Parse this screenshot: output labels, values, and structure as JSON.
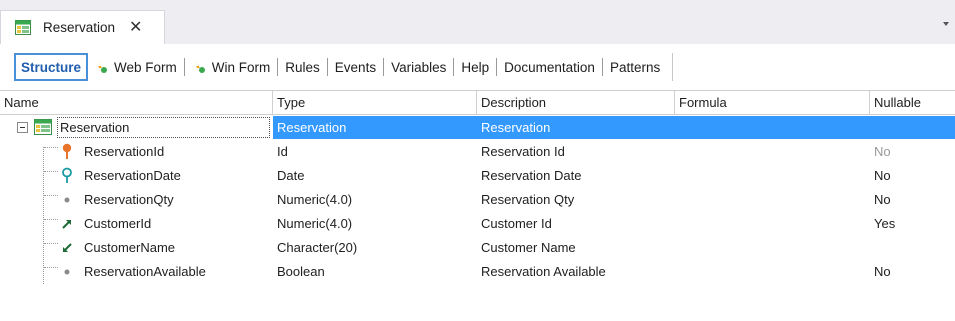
{
  "tab": {
    "title": "Reservation",
    "close": "✕"
  },
  "subtabs": {
    "structure": "Structure",
    "web_form": "Web Form",
    "win_form": "Win Form",
    "rules": "Rules",
    "events": "Events",
    "variables": "Variables",
    "help": "Help",
    "documentation": "Documentation",
    "patterns": "Patterns"
  },
  "columns": {
    "name": "Name",
    "type": "Type",
    "description": "Description",
    "formula": "Formula",
    "nullable": "Nullable"
  },
  "root": {
    "name": "Reservation",
    "type": "Reservation",
    "description": "Reservation"
  },
  "rows": [
    {
      "name": "ReservationId",
      "type": "Id",
      "description": "Reservation Id",
      "nullable": "No",
      "icon": "key-icon"
    },
    {
      "name": "ReservationDate",
      "type": "Date",
      "description": "Reservation Date",
      "nullable": "No",
      "icon": "search-key-icon"
    },
    {
      "name": "ReservationQty",
      "type": "Numeric(4.0)",
      "description": "Reservation Qty",
      "nullable": "No",
      "icon": "dot-icon"
    },
    {
      "name": "CustomerId",
      "type": "Numeric(4.0)",
      "description": "Customer Id",
      "nullable": "Yes",
      "icon": "foreign-key-icon"
    },
    {
      "name": "CustomerName",
      "type": "Character(20)",
      "description": "Customer Name",
      "nullable": "",
      "icon": "inferred-icon"
    },
    {
      "name": "ReservationAvailable",
      "type": "Boolean",
      "description": "Reservation Available",
      "nullable": "No",
      "icon": "dot-icon"
    }
  ],
  "colors": {
    "selection": "#3399ff",
    "active_tab": "#1f5fae",
    "key_orange": "#e8742a",
    "candidate_teal": "#1a9aa5",
    "table_green": "#3aa84f"
  }
}
